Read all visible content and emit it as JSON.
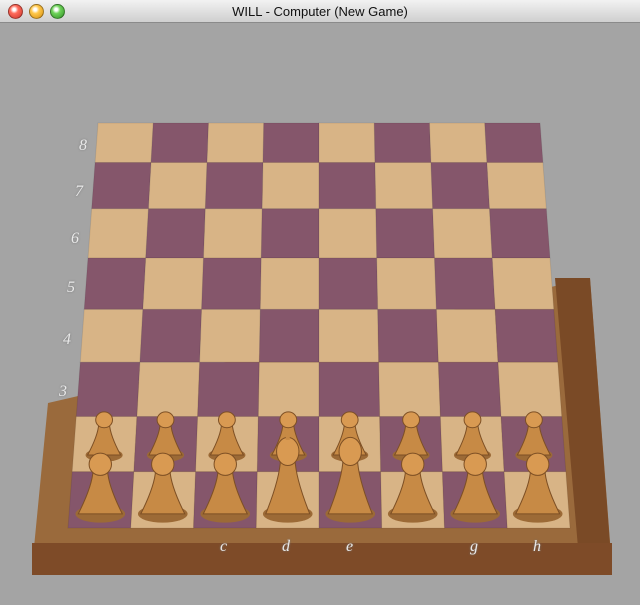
{
  "window": {
    "title": "WILL  - Computer   (New Game)"
  },
  "board": {
    "rank_labels": [
      "8",
      "7",
      "6",
      "5",
      "4",
      "3"
    ],
    "file_labels": [
      "c",
      "d",
      "e",
      "g",
      "h"
    ],
    "light_color": "#d8b486",
    "dark_color": "#85566b",
    "frame_color": "#8a5a32"
  },
  "pieces": {
    "white": [
      "pawn",
      "pawn",
      "pawn",
      "pawn",
      "pawn",
      "pawn",
      "pawn",
      "pawn",
      "rook",
      "knight",
      "bishop",
      "king",
      "queen",
      "bishop",
      "knight",
      "rook"
    ]
  }
}
